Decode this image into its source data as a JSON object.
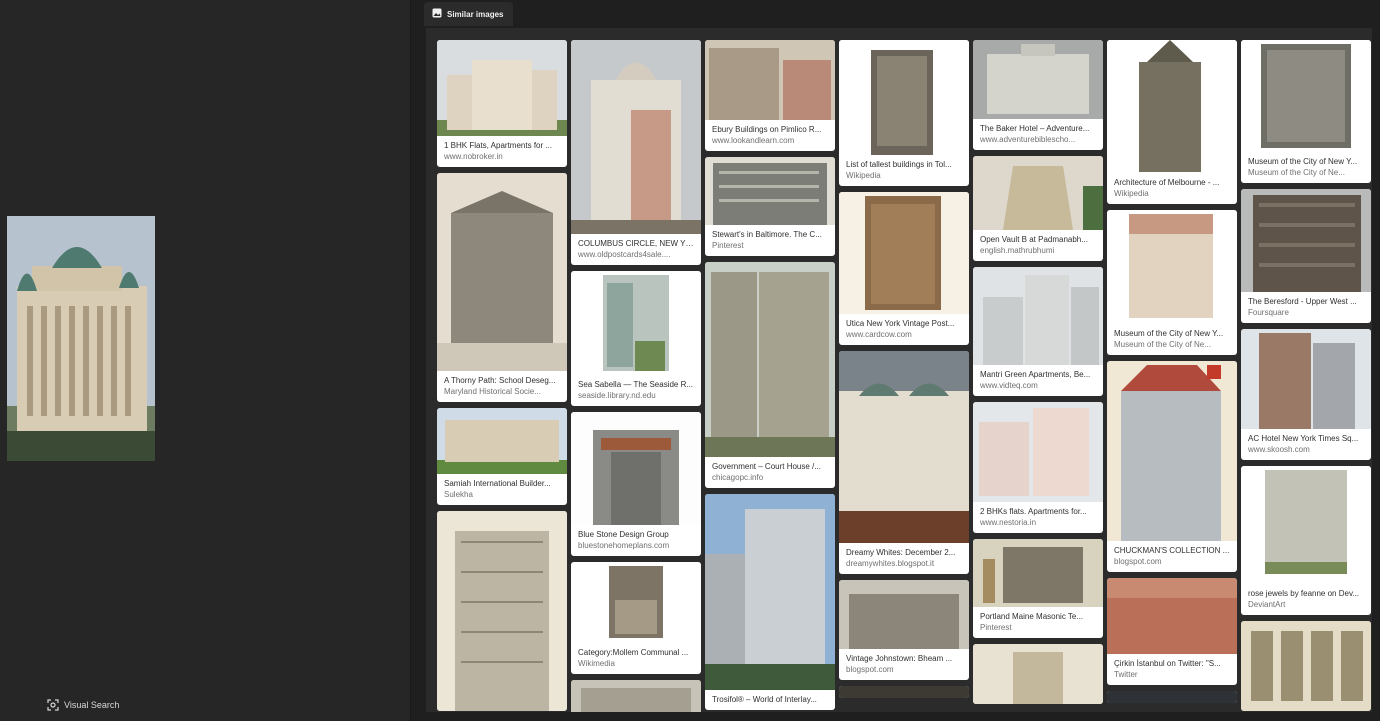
{
  "left_panel": {
    "visual_search_label": "Visual Search"
  },
  "tabs": {
    "similar_images": "Similar images"
  },
  "results": {
    "col1": [
      {
        "title": "1 BHK Flats, Apartments for ...",
        "source": "www.nobroker.in"
      },
      {
        "title": "A Thorny Path: School Deseg...",
        "source": "Maryland Historical Socie..."
      },
      {
        "title": "Samiah International Builder...",
        "source": "Sulekha"
      },
      {
        "title": "",
        "source": ""
      }
    ],
    "col2": [
      {
        "title": "COLUMBUS CIRCLE, NEW YO...",
        "source": "www.oldpostcards4sale...."
      },
      {
        "title": "Sea Sabella — The Seaside R...",
        "source": "seaside.library.nd.edu"
      },
      {
        "title": "Blue Stone Design Group",
        "source": "bluestonehomeplans.com"
      },
      {
        "title": "Category:Mollem Communal ...",
        "source": "Wikimedia"
      },
      {
        "title": "",
        "source": ""
      }
    ],
    "col3": [
      {
        "title": "Ebury Buildings on Pimlico R...",
        "source": "www.lookandlearn.com"
      },
      {
        "title": "Stewart's in Baltimore. The C...",
        "source": "Pinterest"
      },
      {
        "title": "Government – Court House /...",
        "source": "chicagopc.info"
      },
      {
        "title": "Trosifol® – World of Interlay...",
        "source": ""
      }
    ],
    "col4": [
      {
        "title": "List of tallest buildings in Tol...",
        "source": "Wikipedia"
      },
      {
        "title": "Utica New York Vintage Post...",
        "source": "www.cardcow.com"
      },
      {
        "title": "Dreamy Whites: December 2...",
        "source": "dreamywhites.blogspot.it"
      },
      {
        "title": "Vintage Johnstown: Bheam ...",
        "source": "blogspot.com"
      },
      {
        "title": "",
        "source": ""
      }
    ],
    "col5": [
      {
        "title": "The Baker Hotel – Adventure...",
        "source": "www.adventurebiblescho..."
      },
      {
        "title": "Open Vault B at Padmanabh...",
        "source": "english.mathrubhumi"
      },
      {
        "title": "Mantri Green Apartments, Be...",
        "source": "www.vidteq.com"
      },
      {
        "title": "2 BHKs flats. Apartments for...",
        "source": "www.nestoria.in"
      },
      {
        "title": "Portland Maine Masonic Te...",
        "source": "Pinterest"
      },
      {
        "title": "",
        "source": ""
      }
    ],
    "col6": [
      {
        "title": "Architecture of Melbourne - ...",
        "source": "Wikipedia"
      },
      {
        "title": "Museum of the City of New Y...",
        "source": "Museum of the City of Ne..."
      },
      {
        "title": "CHUCKMAN'S COLLECTION ...",
        "source": "blogspot.com"
      },
      {
        "title": "Çirkin İstanbul on Twitter: \"S...",
        "source": "Twitter"
      },
      {
        "title": "",
        "source": ""
      }
    ],
    "col7": [
      {
        "title": "Museum of the City of New Y...",
        "source": "Museum of the City of Ne..."
      },
      {
        "title": "The Beresford - Upper West ...",
        "source": "Foursquare"
      },
      {
        "title": "AC Hotel New York Times Sq...",
        "source": "www.skoosh.com"
      },
      {
        "title": "rose jewels by feanne on Dev...",
        "source": "DeviantArt"
      },
      {
        "title": "",
        "source": ""
      }
    ]
  }
}
